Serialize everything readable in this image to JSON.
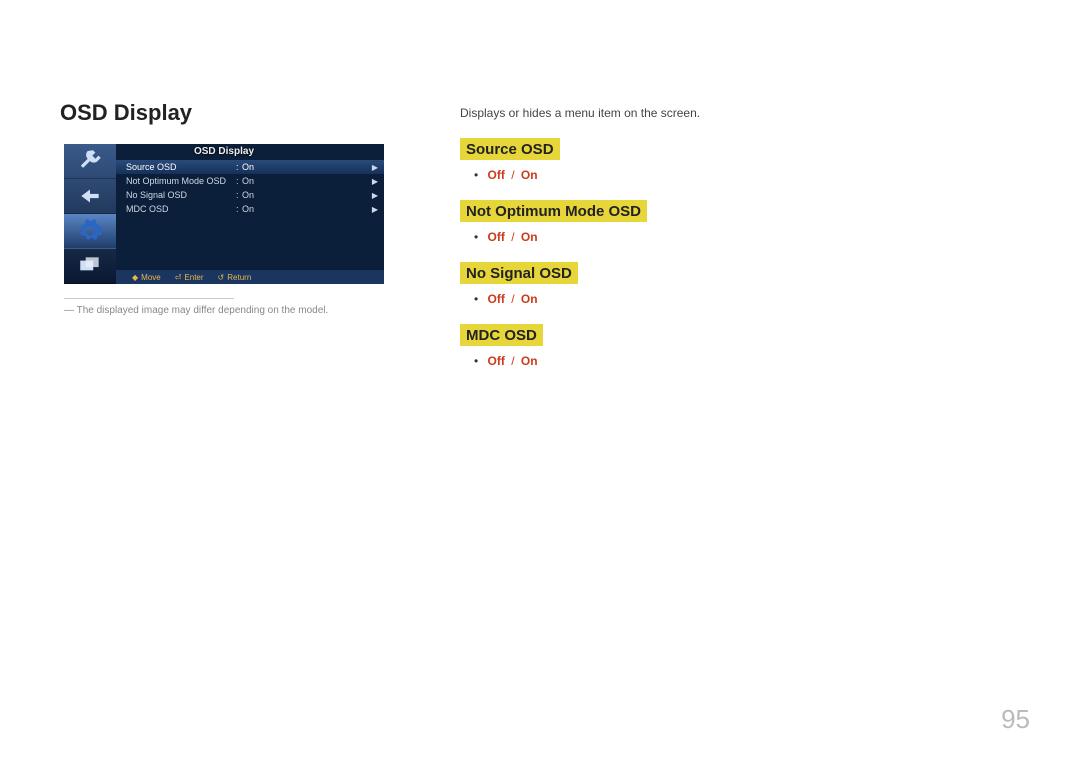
{
  "heading": "OSD Display",
  "osd": {
    "title": "OSD Display",
    "rows": [
      {
        "label": "Source OSD",
        "val": "On"
      },
      {
        "label": "Not Optimum Mode OSD",
        "val": "On"
      },
      {
        "label": "No Signal OSD",
        "val": "On"
      },
      {
        "label": "MDC OSD",
        "val": "On"
      }
    ],
    "footer": {
      "move": "Move",
      "enter": "Enter",
      "return": "Return"
    }
  },
  "note": "The displayed image may differ depending on the model.",
  "intro": "Displays or hides a menu item on the screen.",
  "sections": [
    {
      "title": "Source OSD",
      "opts": [
        "Off",
        "On"
      ]
    },
    {
      "title": "Not Optimum Mode OSD",
      "opts": [
        "Off",
        "On"
      ]
    },
    {
      "title": "No Signal OSD",
      "opts": [
        "Off",
        "On"
      ]
    },
    {
      "title": "MDC OSD",
      "opts": [
        "Off",
        "On"
      ]
    }
  ],
  "pageNumber": "95"
}
